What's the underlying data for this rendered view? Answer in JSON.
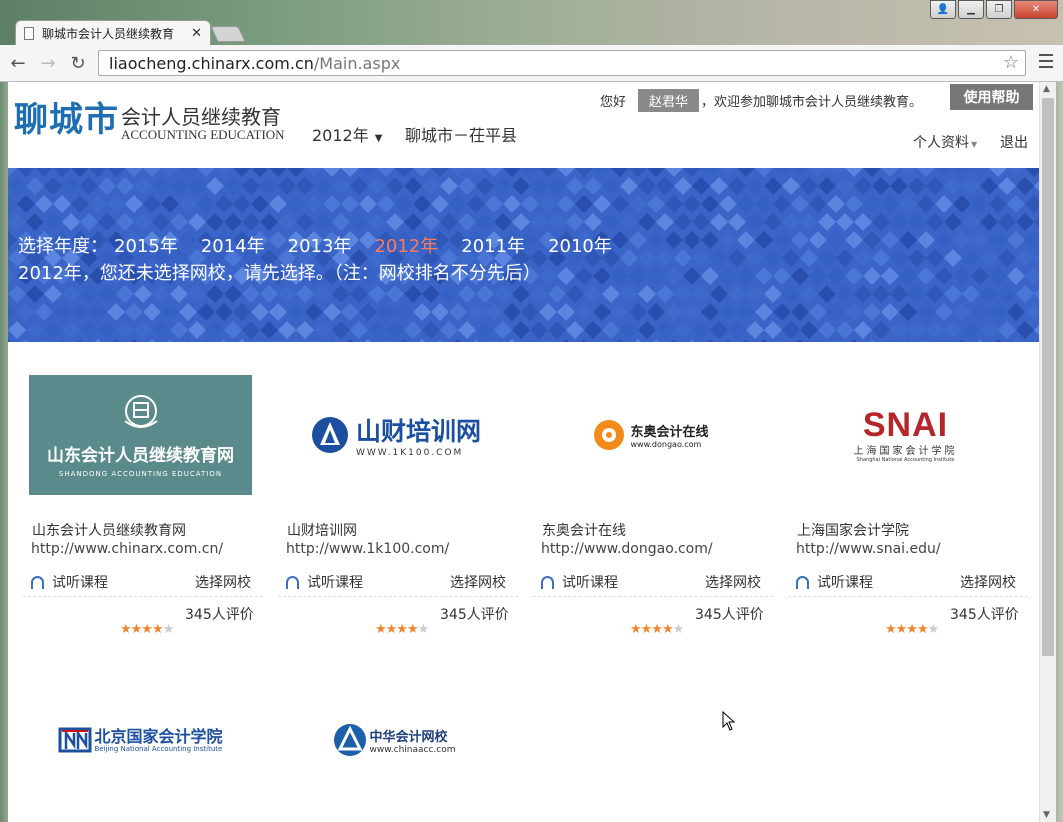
{
  "browser": {
    "tab_title": "聊城市会计人员继续教育",
    "url_host": "liaocheng.chinarx.com.cn",
    "url_path": "/Main.aspx"
  },
  "header": {
    "logo_city": "聊城市",
    "logo_cn": "会计人员继续教育",
    "logo_en": "ACCOUNTING EDUCATION",
    "year": "2012年",
    "region": "聊城市－茌平县",
    "greet_prefix": "您好",
    "user_name": "赵君华",
    "greet_suffix": "，欢迎参加聊城市会计人员继续教育。",
    "help": "使用帮助",
    "profile": "个人资料",
    "logout": "退出"
  },
  "banner": {
    "year_label": "选择年度：",
    "years": [
      "2015年",
      "2014年",
      "2013年",
      "2012年",
      "2011年",
      "2010年"
    ],
    "active_year": "2012年",
    "notice": "2012年，您还未选择网校，请先选择。（注：网校排名不分先后）"
  },
  "schools": [
    {
      "name": "山东会计人员继续教育网",
      "url": "http://www.chinarx.com.cn/",
      "logo_text": "山东会计人员继续教育网",
      "logo_sub": "SHANDONG  ACCOUNTING  EDUCATION",
      "trial": "试听课程",
      "select": "选择网校",
      "count": "345人评价",
      "rating": 4.5
    },
    {
      "name": "山财培训网",
      "url": "http://www.1k100.com/",
      "logo_text": "山财培训网",
      "logo_sub": "WWW.1K100.COM",
      "trial": "试听课程",
      "select": "选择网校",
      "count": "345人评价",
      "rating": 4.5
    },
    {
      "name": "东奥会计在线",
      "url": "http://www.dongao.com/",
      "logo_text": "东奥会计在线",
      "logo_sub": "www.dongao.com",
      "trial": "试听课程",
      "select": "选择网校",
      "count": "345人评价",
      "rating": 4.5
    },
    {
      "name": "上海国家会计学院",
      "url": "http://www.snai.edu/",
      "logo_text": "SNAI",
      "logo_sub": "上海国家会计学院",
      "logo_sub2": "Shanghai National Accounting Institute",
      "trial": "试听课程",
      "select": "选择网校",
      "count": "345人评价",
      "rating": 4.5
    }
  ],
  "more_schools": [
    {
      "logo_text": "北京国家会计学院",
      "logo_sub": "Beijing National Accounting Institute"
    },
    {
      "logo_text": "中华会计网校",
      "logo_sub": "www.chinaacc.com"
    }
  ],
  "colors": {
    "accent": "#1e6eb3",
    "banner": "#3a64c7",
    "active_year": "#ff7a5a",
    "star": "#f2862e"
  }
}
